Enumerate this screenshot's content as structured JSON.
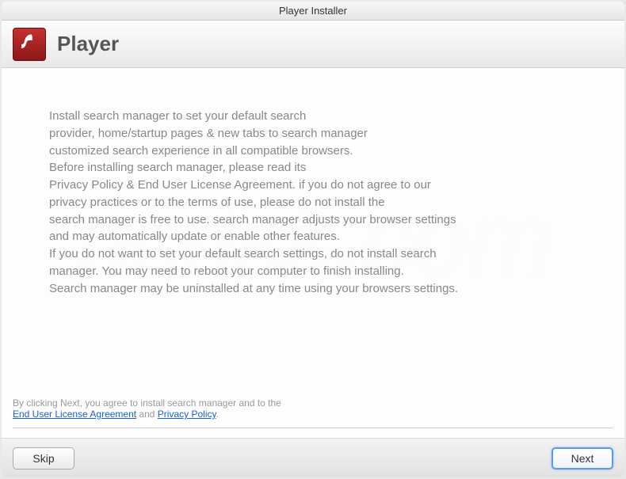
{
  "window": {
    "title": "Player Installer"
  },
  "header": {
    "title": "Player"
  },
  "body": {
    "text": "Install search manager to set your default search\nprovider, home/startup pages & new tabs to search manager\ncustomized search experience in all compatible browsers.\nBefore installing search manager, please read its\nPrivacy Policy & End User License Agreement. if you do not agree to our\nprivacy practices or to the terms of use, please do not install the\nsearch manager is free to use. search manager adjusts your browser settings\nand may automatically update or enable other features.\nIf you do not want to set your default search settings, do not install search\nmanager. You may need to reboot your computer to finish installing.\nSearch manager may be uninstalled at any time using your browsers settings."
  },
  "footer": {
    "prefix": "By clicking Next, you agree to install search manager and to the",
    "eula": "End User License Agreement",
    "and": " and ",
    "privacy": "Privacy Policy",
    "suffix": "."
  },
  "buttons": {
    "skip": "Skip",
    "next": "Next"
  },
  "watermark": {
    "text": "pcrisk.com"
  }
}
